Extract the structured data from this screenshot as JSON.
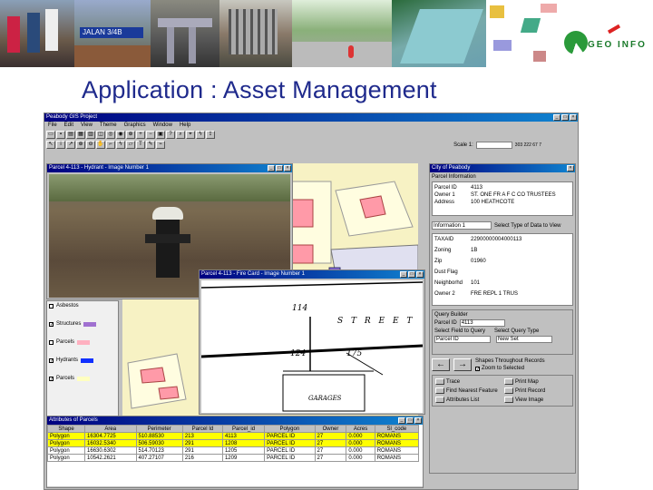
{
  "banner": {
    "street_sign": "JALAN 3/4B",
    "logo_text": "GEO INFO"
  },
  "slide_title": "Application : Asset Management",
  "app": {
    "title": "Peabody GIS Project",
    "menu": [
      "File",
      "Edit",
      "View",
      "Theme",
      "Graphics",
      "Window",
      "Help"
    ],
    "scale_label": "Scale 1:",
    "coords": "303 222 67 7"
  },
  "hydrant_window": {
    "title": "Parcel 4-113 - Hydrant - Image Number 1"
  },
  "firecard_window": {
    "title": "Parcel 4-113 - Fire Card - Image Number 1",
    "street_text": "S T R E E T",
    "label_a": "114",
    "label_b": "124",
    "label_c": "175",
    "garage": "GARAGES"
  },
  "legend": {
    "items": [
      {
        "label": "Asbestos",
        "color": "#6fa0e0"
      },
      {
        "label": "Structures",
        "color": "#a070d0"
      },
      {
        "label": "Parcels",
        "color": "#ffb0c0"
      },
      {
        "label": "Hydrants",
        "color": "#1030ff"
      },
      {
        "label": "Parcels",
        "color": "#ffffc0"
      }
    ]
  },
  "city_panel": {
    "title": "City of Peabody",
    "parcel_info_label": "Parcel Information",
    "fields": [
      {
        "k": "Parcel ID",
        "v": "4113"
      },
      {
        "k": "Owner 1",
        "v": "ST. ONE FR A F C CO TRUSTEES"
      },
      {
        "k": "Address",
        "v": "100 HEATHCOTE"
      }
    ],
    "dropdown_value": "Information 1",
    "dropdown_hint": "Select Type of Data to View",
    "fields2": [
      {
        "k": "TAXAID",
        "v": "22900000004000113"
      },
      {
        "k": "Zoning",
        "v": "1B"
      },
      {
        "k": "Zip",
        "v": "01960"
      },
      {
        "k": "Dust Flag",
        "v": ""
      },
      {
        "k": "Neighborhd",
        "v": "101"
      },
      {
        "k": "Owner 2",
        "v": "FRE REPL 1 TRUS"
      }
    ],
    "query_builder": "Query Builder",
    "parcel_id_label": "Parcel ID",
    "parcel_id_value": "4113",
    "select_field": "Select Field to Query",
    "select_type": "Select Query Type",
    "field_value": "Parcel ID",
    "type_value": "New Set",
    "zoom_label": "Zoom to Selected",
    "show_all": "Shapes Throughout Records",
    "actions": [
      "Trace",
      "Print Map",
      "Find Nearest Feature",
      "Print Record",
      "Attributes List",
      "View Image"
    ]
  },
  "attr_table": {
    "title": "Attributes of Parcels",
    "headers": [
      "Shape",
      "Area",
      "Perimeter",
      "Parcel Id",
      "Parcel_id",
      "Polygon",
      "Owner",
      "Acres",
      "Sl_code"
    ],
    "rows": [
      [
        "Polygon",
        "16304.7725",
        "510.88530",
        "213",
        "4113",
        "PARCEL ID",
        "27",
        "0.000",
        "ROMANS"
      ],
      [
        "Polygon",
        "16032.5340",
        "506.59030",
        "291",
        "1208",
        "PARCEL ID",
        "27",
        "0.000",
        "ROMANS"
      ],
      [
        "Polygon",
        "16630.6302",
        "514.70123",
        "291",
        "1205",
        "PARCEL ID",
        "27",
        "0.000",
        "ROMANS"
      ],
      [
        "Polygon",
        "10542.2621",
        "407.27107",
        "216",
        "1209",
        "PARCEL ID",
        "27",
        "0.000",
        "ROMANS"
      ]
    ]
  },
  "colors": {
    "title_blue": "#1f2a8c",
    "win_title": "#000080",
    "map_bg": "#f7f2c4",
    "parcel_red": "#ff9aa8",
    "highlight": "#ffff00"
  }
}
